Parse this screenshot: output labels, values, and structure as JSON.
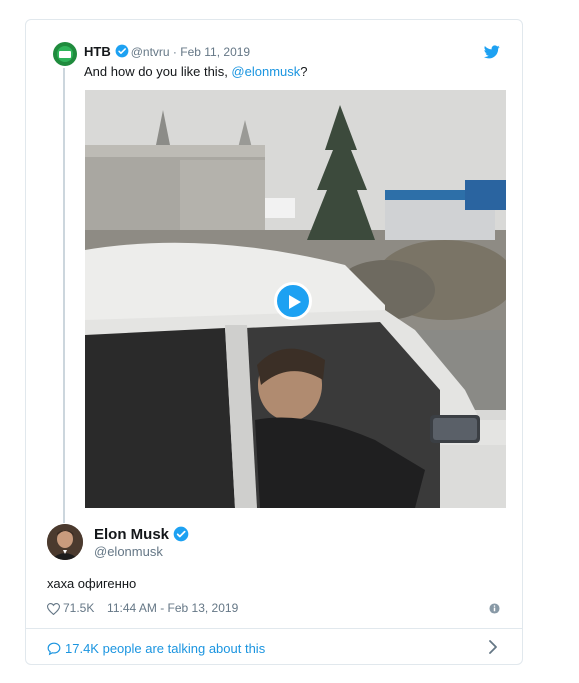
{
  "quoted_tweet": {
    "display_name": "НТВ",
    "handle": "@ntvru",
    "separator": "·",
    "date": "Feb 11, 2019",
    "text_prefix": "And how do you like this, ",
    "mention": "@elonmusk",
    "text_suffix": "?",
    "media": {
      "type": "video",
      "play_icon": "play-icon"
    }
  },
  "reply_tweet": {
    "display_name": "Elon Musk",
    "handle": "@elonmusk",
    "text": "хаха офигенно",
    "likes": "71.5K",
    "timestamp": "11:44 AM - Feb 13, 2019"
  },
  "footer": {
    "talking_text": "17.4K people are talking about this"
  },
  "icons": {
    "verified": "verified-badge-icon",
    "twitter": "twitter-bird-icon",
    "heart": "heart-icon",
    "info": "info-icon",
    "comment": "comment-bubble-icon",
    "chevron": "chevron-right-icon"
  },
  "colors": {
    "accent": "#1da1f2",
    "link": "#1b95e0",
    "muted": "#657786",
    "border": "#e1e8ed"
  }
}
